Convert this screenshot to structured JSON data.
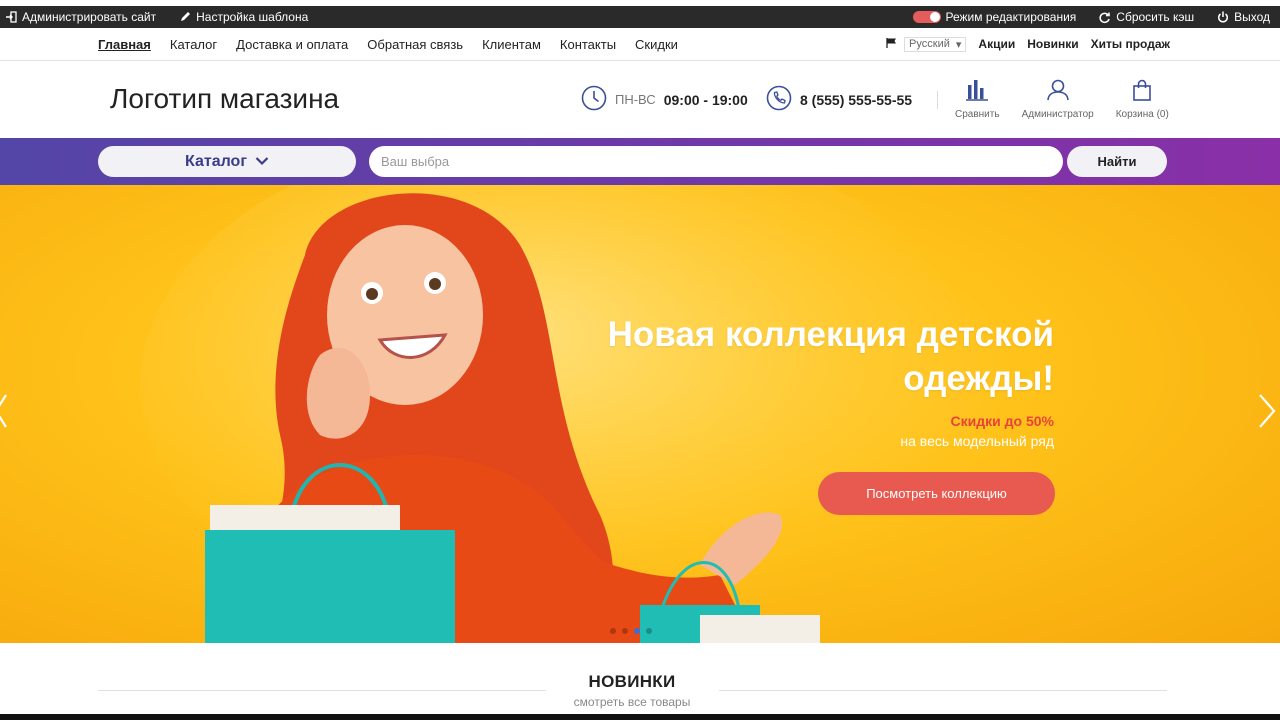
{
  "admin_bar": {
    "manage_site": "Администрировать сайт",
    "template_settings": "Настройка шаблона",
    "edit_mode": "Режим редактирования",
    "reset_cache": "Сбросить кэш",
    "logout": "Выход"
  },
  "topnav": {
    "links": [
      "Главная",
      "Каталог",
      "Доставка и оплата",
      "Обратная связь",
      "Клиентам",
      "Контакты",
      "Скидки"
    ],
    "language": "Русский",
    "right_links": [
      "Акции",
      "Новинки",
      "Хиты продаж"
    ]
  },
  "header": {
    "logo": "Логотип магазина",
    "hours_label": "ПН-ВС",
    "hours_value": "09:00 - 19:00",
    "phone": "8 (555) 555-55-55",
    "compare": "Сравнить",
    "account": "Администратор",
    "cart": "Корзина (0)"
  },
  "search": {
    "catalog_label": "Каталог",
    "placeholder": "Ваш выбра",
    "button": "Найти"
  },
  "hero": {
    "title_line1": "Новая коллекция детской",
    "title_line2": "одежды!",
    "sale": "Скидки до 50%",
    "subtitle": "на весь модельный ряд",
    "button": "Посмотреть коллекцию",
    "slides_count": 4,
    "active_slide": 3
  },
  "new_section": {
    "title": "НОВИНКИ",
    "link": "смотреть все товары"
  },
  "colors": {
    "accent": "#e85a4f",
    "searchbar_start": "#5346a6",
    "searchbar_end": "#8a2fa7",
    "hero_bg": "#ffc21a",
    "sale_text": "#e8433a"
  }
}
